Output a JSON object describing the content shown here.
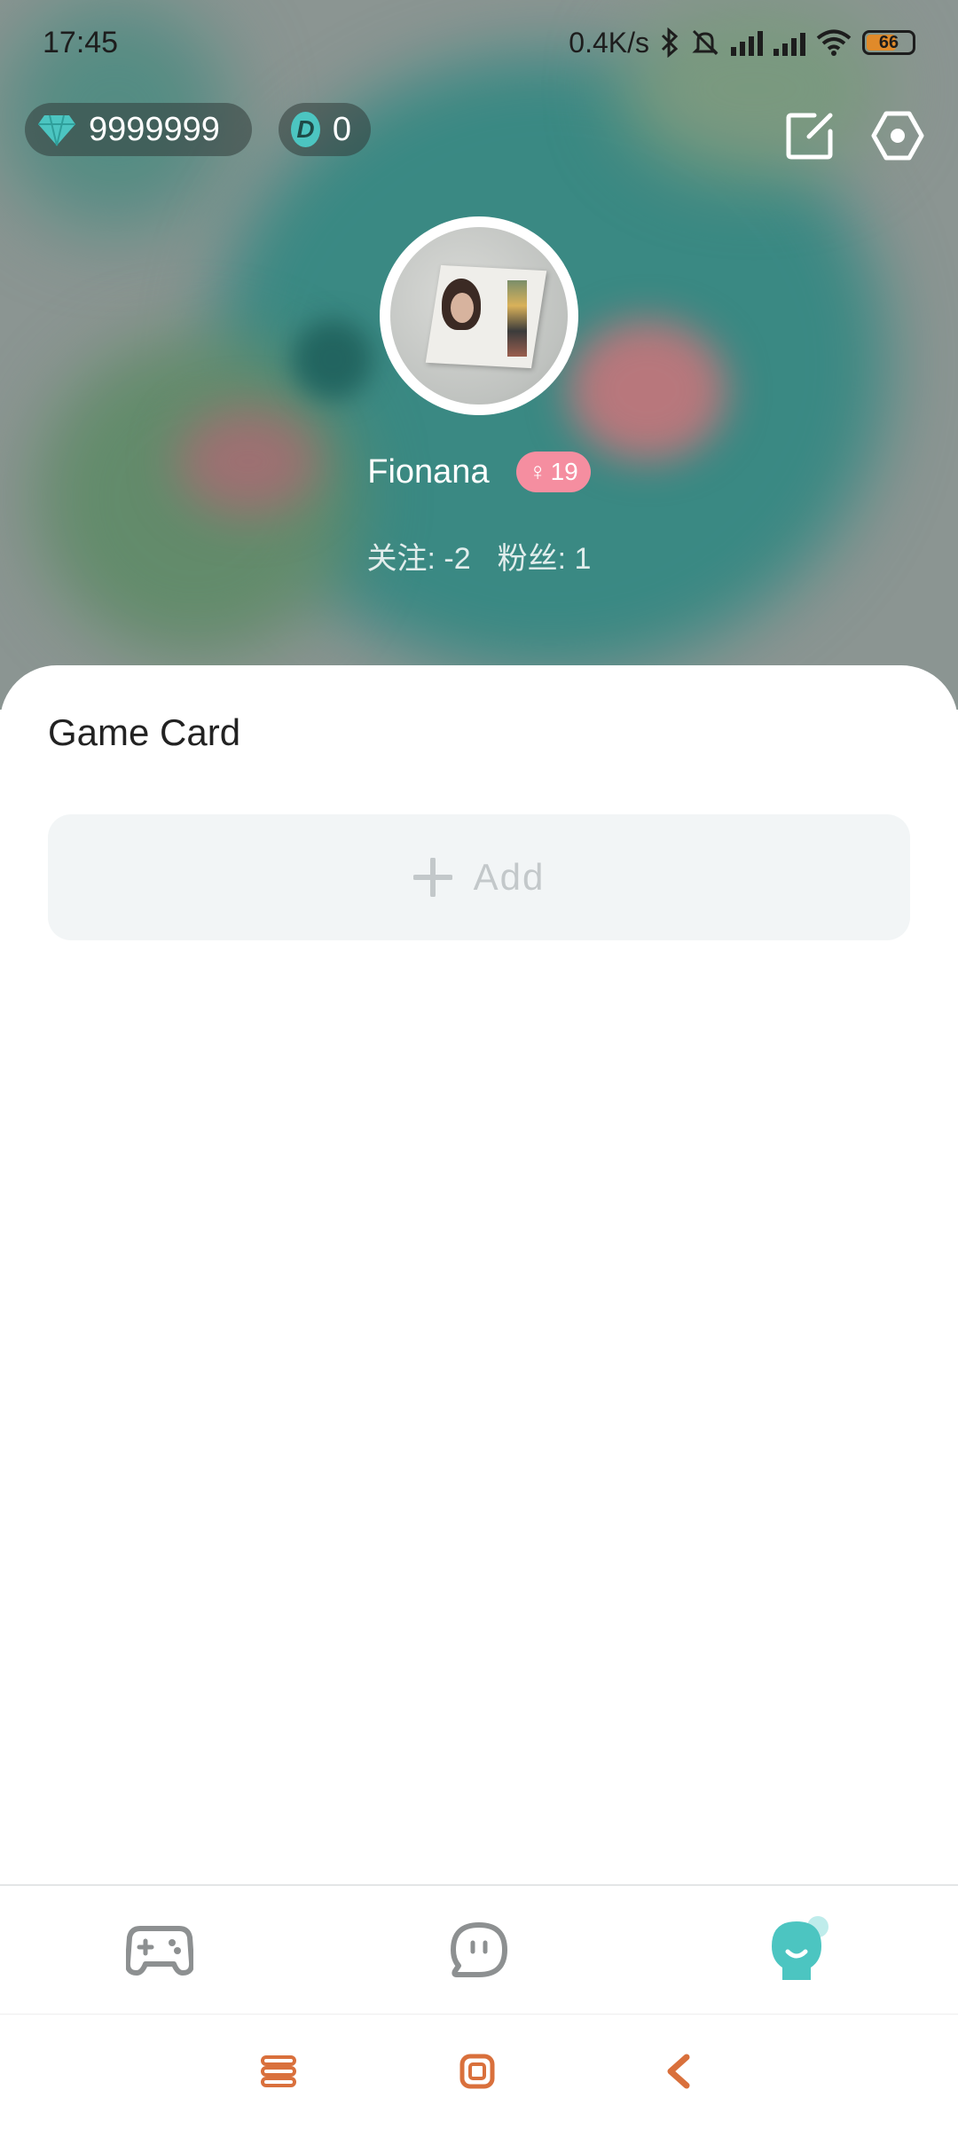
{
  "status_bar": {
    "time": "17:45",
    "network_speed": "0.4K/s",
    "battery": "66",
    "icons": [
      "bluetooth-icon",
      "mute-icon",
      "hd-signal-icon",
      "signal-icon",
      "wifi-icon",
      "battery-icon"
    ]
  },
  "wallet": {
    "diamonds": "9999999",
    "coins": "0",
    "coin_symbol": "D"
  },
  "header_actions": {
    "edit_icon": "edit-icon",
    "settings_icon": "settings-icon"
  },
  "profile": {
    "name": "Fionana",
    "gender_symbol": "♀",
    "age": "19",
    "following": "关注: -2",
    "followers": "粉丝: 1"
  },
  "game_card": {
    "title": "Game Card",
    "add_label": "Add"
  },
  "bottom_nav": {
    "items": [
      "gamepad-icon",
      "chat-icon",
      "profile-icon"
    ],
    "active": "profile-icon"
  },
  "colors": {
    "accent": "#4cc5c1",
    "badge": "#f58ea0",
    "system_nav": "#d9703c"
  }
}
